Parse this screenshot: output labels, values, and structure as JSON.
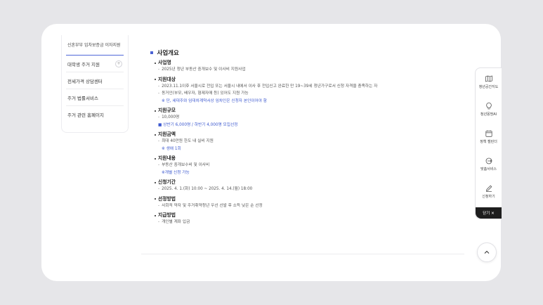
{
  "sidebar": {
    "items": [
      {
        "label": "신혼부부 임차보증금 이자지원"
      },
      {
        "label": "대학생 주거 지원"
      },
      {
        "label": "전세가격 상담센터"
      },
      {
        "label": "주거 법률서비스"
      },
      {
        "label": "주거 관련 홈페이지"
      }
    ],
    "plus": "+"
  },
  "main": {
    "title": "사업개요",
    "blocks": [
      {
        "head": "사업명",
        "lines": [
          "2025년 청년 부동산 중개보수 및 이사비 지원사업"
        ]
      },
      {
        "head": "지원대상",
        "lines": [
          "2023.11.1이후 서울시로 전입 또는 서울시 내에서 이사 후 전입신고 완료한 만 19~39세 청년가구로서 신청 자격을 충족하는 자",
          "동거인(부모, 배우자, 형제자매 등) 있어도 지원 가능"
        ],
        "note": "※ 단, 세대주와 임대차계약서상 임차인은 신청자 본인이어야 함"
      },
      {
        "head": "지원규모",
        "lines": [
          "10,000명"
        ],
        "note": "■ 상반기 6,000명 / 하반기 4,000명 모집선정"
      },
      {
        "head": "지원금액",
        "lines": [
          "최대 40만원 한도 내 실비 지원"
        ],
        "note": "※ 생애 1회"
      },
      {
        "head": "지원내용",
        "lines": [
          "부동산 중개보수비 및 이사비"
        ],
        "note": "※개별 신청 가능"
      },
      {
        "head": "신청기간",
        "lines": [
          "2025. 4. 1.(화) 10:00 ~ 2025. 4. 14.(월) 18:00"
        ]
      },
      {
        "head": "선정방법",
        "lines": [
          "사회적 약자 및 주거취약청년 우선 선발 후 소득 낮은 순 선정"
        ]
      },
      {
        "head": "지급방법",
        "lines": [
          "개인별 계좌 입금"
        ]
      }
    ]
  },
  "quick_menu": {
    "items": [
      {
        "label": "청년공간지도",
        "icon": "map-icon"
      },
      {
        "label": "청년몽땅AI",
        "icon": "lightbulb-icon"
      },
      {
        "label": "정책 캘린더",
        "icon": "calendar-icon"
      },
      {
        "label": "맞춤서비스",
        "icon": "target-arrow-icon"
      },
      {
        "label": "신청하기",
        "icon": "pencil-icon"
      }
    ],
    "close_label": "닫기 ✕"
  },
  "colors": {
    "accent": "#4a62d4",
    "note": "#3c58cf",
    "background": "#e6e6e9"
  }
}
